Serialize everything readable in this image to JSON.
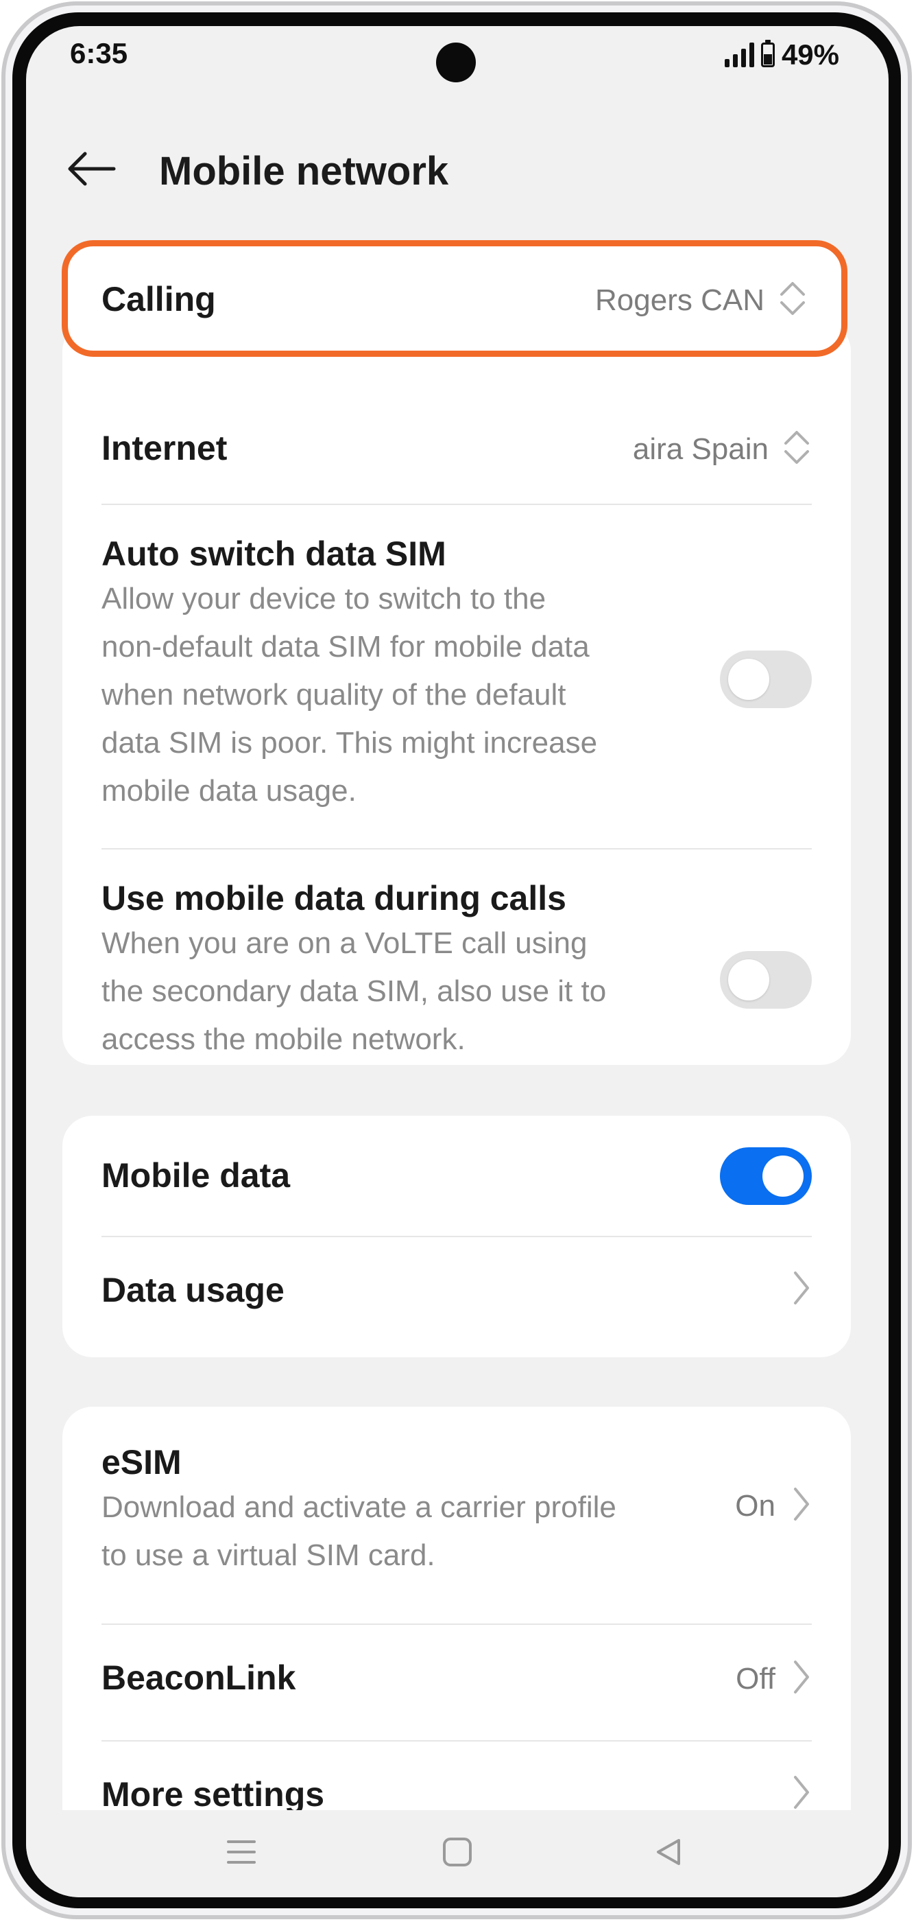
{
  "status_bar": {
    "time": "6:35",
    "battery_percent": "49%",
    "battery_level": 0.49
  },
  "header": {
    "title": "Mobile network"
  },
  "sim_card": {
    "calling": {
      "label": "Calling",
      "value": "Rogers CAN"
    },
    "internet": {
      "label": "Internet",
      "value": "aira Spain"
    },
    "auto_switch": {
      "label": "Auto switch data SIM",
      "desc_lines": [
        "Allow your device to switch to the",
        "non-default data SIM for mobile data",
        "when network quality of the default",
        "data SIM is poor. This might increase",
        "mobile data usage."
      ],
      "enabled": false
    },
    "data_during_calls": {
      "label": "Use mobile data during calls",
      "desc_lines": [
        "When you are on a VoLTE call using",
        "the secondary data SIM, also use it to",
        "access the mobile network."
      ],
      "enabled": false
    }
  },
  "data_card": {
    "mobile_data": {
      "label": "Mobile data",
      "enabled": true
    },
    "data_usage": {
      "label": "Data usage"
    }
  },
  "more_card": {
    "esim": {
      "label": "eSIM",
      "desc_lines": [
        "Download and activate a carrier profile",
        "to use a virtual SIM card."
      ],
      "value": "On"
    },
    "beaconlink": {
      "label": "BeaconLink",
      "value": "Off"
    },
    "more_settings": {
      "label": "More settings"
    }
  },
  "colors": {
    "accent": "#0a6ff0",
    "highlight": "#f26a28"
  }
}
